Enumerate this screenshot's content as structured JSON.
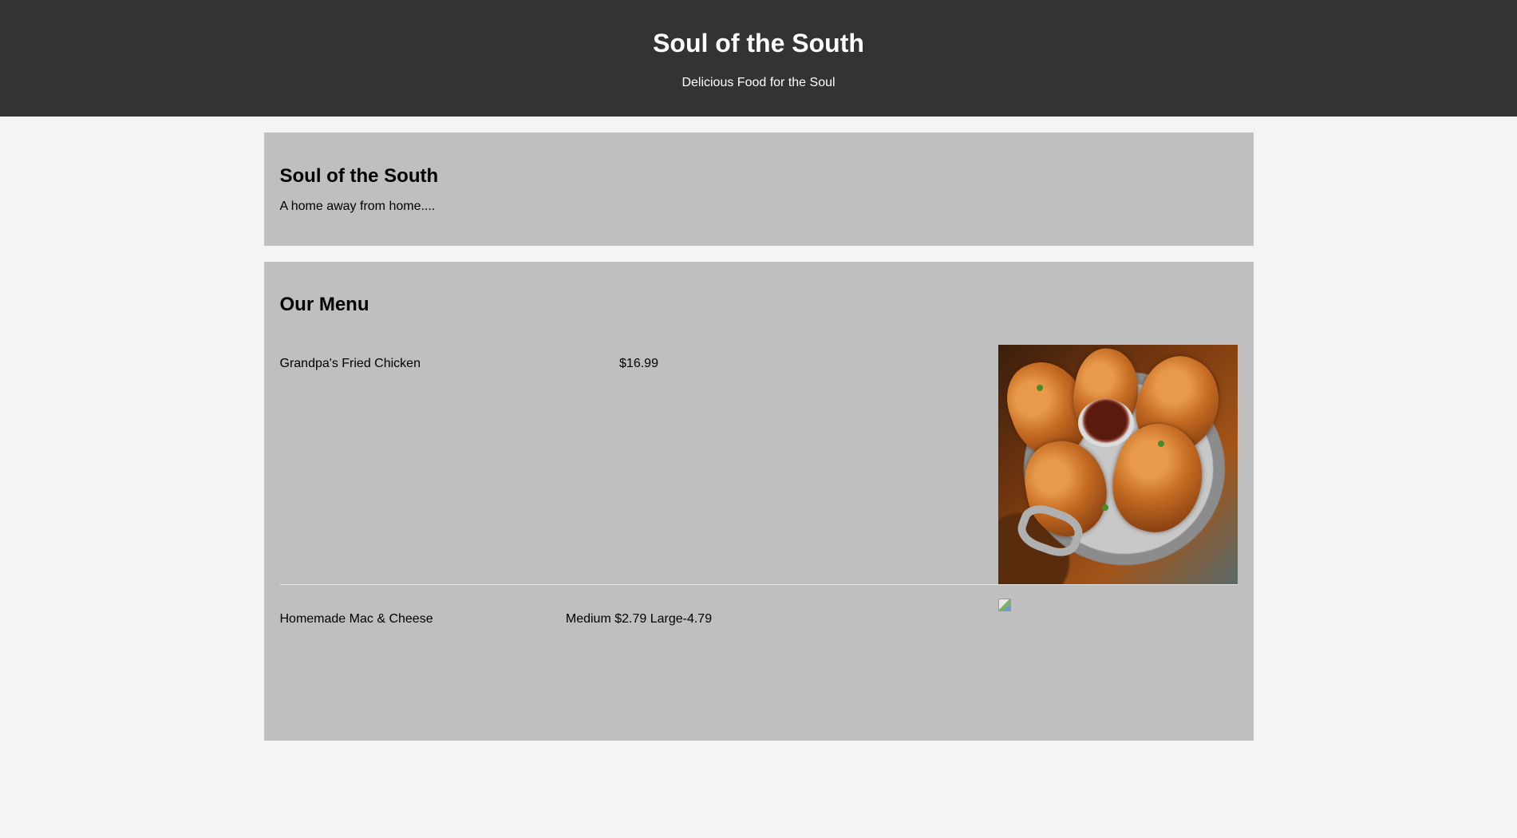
{
  "header": {
    "title": "Soul of the South",
    "tagline": "Delicious Food for the Soul"
  },
  "intro": {
    "title": "Soul of the South",
    "text": "A home away from home...."
  },
  "menu": {
    "title": "Our Menu",
    "items": [
      {
        "name": "Grandpa's Fried Chicken",
        "price": "$16.99",
        "image": "fried-chicken-photo"
      },
      {
        "name": "Homemade Mac & Cheese",
        "price": "Medium $2.79 Large-4.79",
        "image": "broken-image-icon"
      }
    ]
  },
  "colors": {
    "header_bg": "#333333",
    "page_bg": "#f4f4f4",
    "panel_bg": "#bfbfbf",
    "divider": "#e6e6e6"
  }
}
